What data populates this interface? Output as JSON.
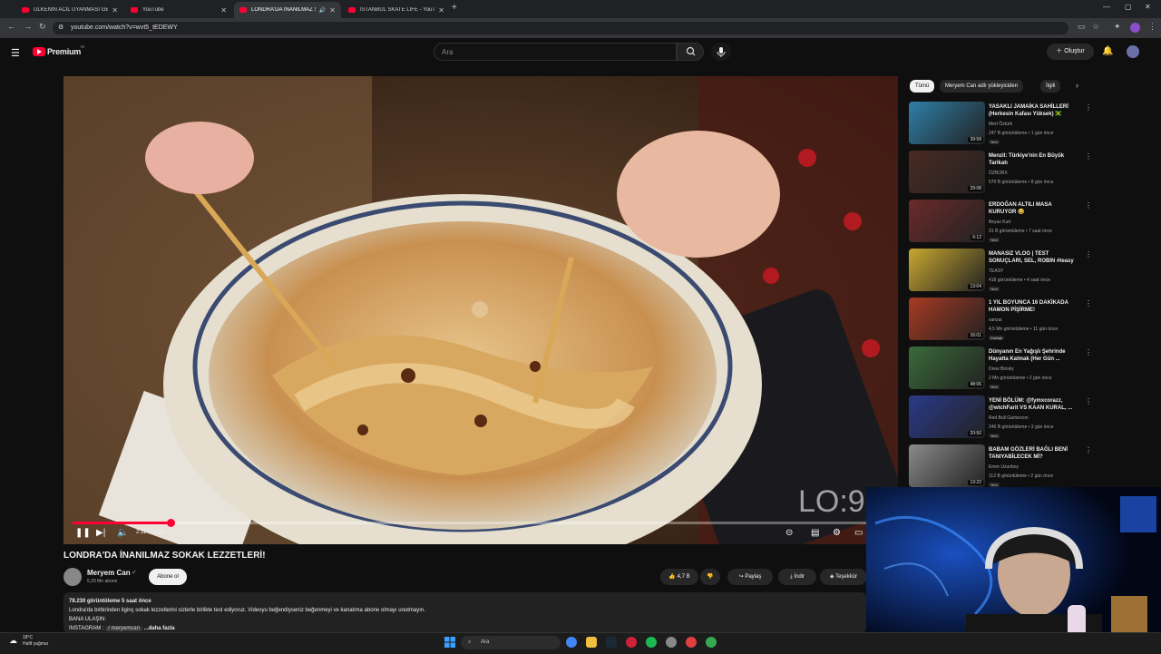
{
  "browser": {
    "tabs": [
      {
        "title": "ÜLKENİN ACİL UYANMASI GER",
        "active": false
      },
      {
        "title": "YouTube",
        "active": false
      },
      {
        "title": "LONDRA'DA İNANILMAZ S",
        "active": true
      },
      {
        "title": "İSTANBUL SKATE LIFE - YouTube",
        "active": false
      }
    ],
    "url": "youtube.com/watch?v=wvt5_tEDEWY"
  },
  "header": {
    "logo": "Premium",
    "logo_sup": "TR",
    "search_placeholder": "Ara",
    "create_label": "Oluştur"
  },
  "player": {
    "time": "2:11 / 18:20",
    "progress": 0.12,
    "watermark": "LO:9"
  },
  "video": {
    "title": "LONDRA'DA İNANILMAZ SOKAK LEZZETLERİ!",
    "channel": "Meryem Can",
    "subscribers": "5,29 Mn abone",
    "subscribe_label": "Abone ol",
    "likes": "4,7 B",
    "share_label": "Paylaş",
    "download_label": "İndir",
    "thanks_label": "Teşekkür"
  },
  "description": {
    "stats": "78.230 görüntüleme  5 saat önce",
    "line1": "Londra'da birbirinden ilginç sokak lezzetlerini sizlerle birlikte test ediyoruz. Videoyu beğendiyseniz beğenmeyi ve kanalıma abone olmayı unutmayın.",
    "line2": "BANA ULAŞIN:",
    "line3": "INSTAGRAM : ",
    "handle": "/ meryemcan",
    "more": "...daha fazla"
  },
  "chips": [
    "Tümü",
    "Meryem Can adlı yükleyiciden",
    "İlgili"
  ],
  "recommendations": [
    {
      "title": "YASAKLI JAMAİKA SAHİLLERİ (Herkesin Kafası Yüksek) 🇯🇲",
      "channel": "Mert Öztürk",
      "meta": "247 B görüntüleme • 1 gün önce",
      "badge": "Yeni",
      "duration": "39:58",
      "color": "#2e7fa8"
    },
    {
      "title": "Menzil: Türkiye'nin En Büyük Tarikatı",
      "channel": "ÖZBÜRX",
      "meta": "570 B görüntüleme • 8 gün önce",
      "badge": "",
      "duration": "29:08",
      "color": "#4a2a22"
    },
    {
      "title": "ERDOĞAN ALTILI MASA KURUYOR 😂",
      "channel": "Beyaz Kurt",
      "meta": "91 B görüntüleme • 7 saat önce",
      "badge": "Yeni",
      "duration": "6:12",
      "color": "#6b2a2a"
    },
    {
      "title": "MANASIZ VLOG | TEST SONUÇLARI, SEL, ROBIN #teasy",
      "channel": "TEASY",
      "meta": "418 görüntüleme • 4 saat önce",
      "badge": "Yeni",
      "duration": "13:04",
      "color": "#c8a830"
    },
    {
      "title": "1 YIL BOYUNCA 16 DAKİKADA HAMON PİŞİRME!",
      "channel": "vanzai",
      "meta": "4,5 Mn görüntüleme • 11 gün önce",
      "badge": "Dublajlı",
      "duration": "16:01",
      "color": "#a83a22"
    },
    {
      "title": "Dünyanın En Yağışlı Şehrinde Hayatta Kalmak (Her Gün ...",
      "channel": "Drew Binsky",
      "meta": "2 Mn görüntüleme • 2 gün önce",
      "badge": "Yeni",
      "duration": "48:06",
      "color": "#3a6a3a"
    },
    {
      "title": "YENİ BÖLÜM: @fymxcorazz, @wtchFarit VS KAAN KURAL, ...",
      "channel": "Red Bull Gamerzon",
      "meta": "246 B görüntüleme • 3 gün önce",
      "badge": "Yeni",
      "duration": "20:50",
      "color": "#2a3a8a"
    },
    {
      "title": "BABAM GÖZLERİ BAĞLI BENİ TANIYABİLECEK Mİ?",
      "channel": "Emre Uzunboy",
      "meta": "112 B görüntüleme • 2 gün önce",
      "badge": "Yeni",
      "duration": "13:22",
      "color": "#8a8a8a"
    }
  ],
  "taskbar": {
    "temp": "18°C",
    "weather": "Hafif yağmur",
    "search": "Ara"
  }
}
